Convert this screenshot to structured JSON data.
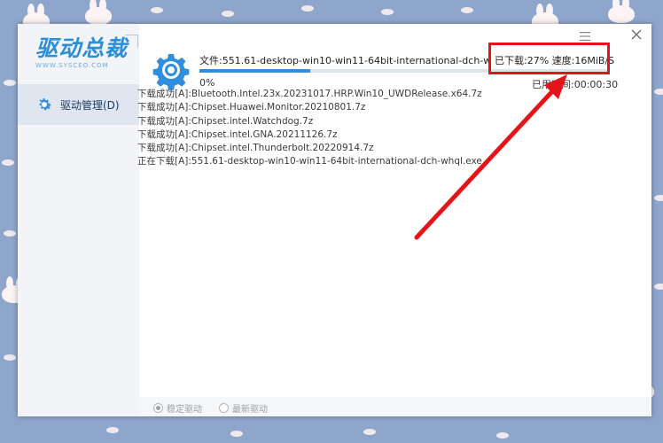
{
  "app": {
    "logo_text": "驱动总裁",
    "logo_subtext": "WWW.SYSCEO.COM"
  },
  "sidebar": {
    "items": [
      {
        "label": "驱动管理(D)",
        "icon": "gear-icon"
      }
    ]
  },
  "download": {
    "file_line": "文件:551.61-desktop-win10-win11-64bit-international-dch-whql.exe",
    "stats_text": "已下载:27% 速度:16MiB/S",
    "progress": 0.27,
    "percent_label": "0%",
    "elapsed_text": "已用时间:00:00:30"
  },
  "log": [
    "下载成功[A]:Bluetooth.Intel.23x.20231017.HRP.Win10_UWDRelease.x64.7z",
    "下载成功[A]:Chipset.Huawei.Monitor.20210801.7z",
    "下载成功[A]:Chipset.intel.Watchdog.7z",
    "下载成功[A]:Chipset.intel.GNA.20211126.7z",
    "下载成功[A]:Chipset.intel.Thunderbolt.20220914.7z",
    "正在下载[A]:551.61-desktop-win10-win11-64bit-international-dch-whql.exe"
  ],
  "footer": {
    "options": [
      {
        "label": "稳定驱动",
        "selected": true
      },
      {
        "label": "最新驱动",
        "selected": false
      }
    ]
  },
  "colors": {
    "accent": "#2f8ee0",
    "annotation": "#e5141a",
    "background": "#8fa6cc"
  }
}
